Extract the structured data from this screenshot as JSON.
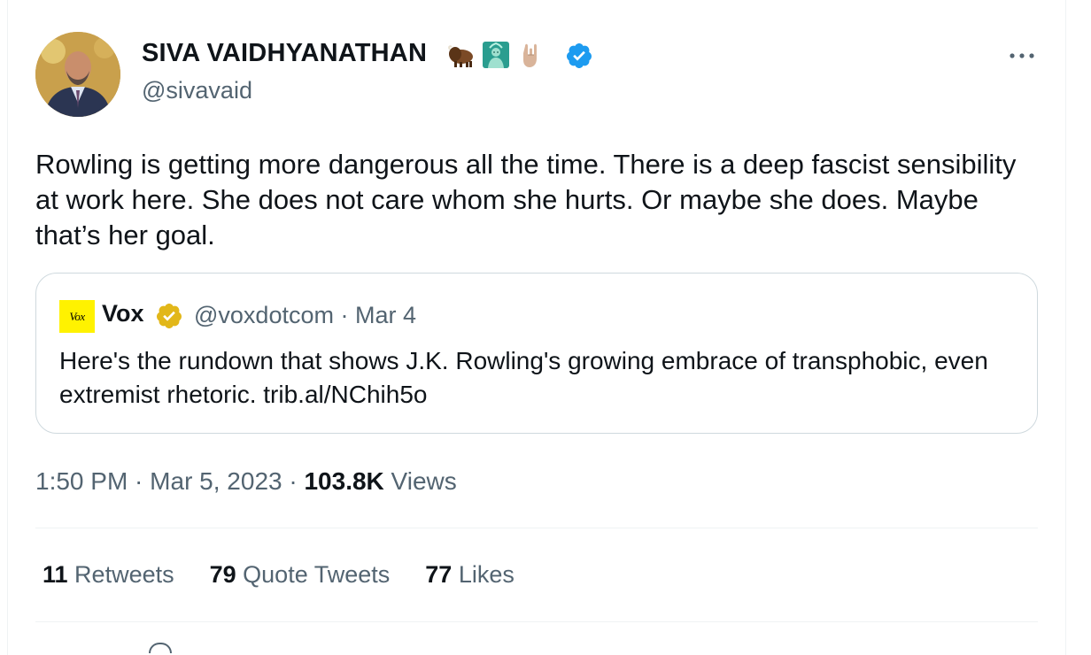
{
  "tweet": {
    "author": {
      "name": "SIVA VAIDHYANATHAN",
      "handle": "@sivavaid",
      "name_emojis": [
        "bison-icon",
        "statue-of-liberty-icon",
        "sign-of-horns-icon"
      ],
      "verified": true
    },
    "text": "Rowling is getting more dangerous all the time. There is a deep fascist sensibility at work here. She does not care whom she hurts. Or maybe she does. Maybe that’s her goal.",
    "quoted": {
      "logo_text": "Vox",
      "name": "Vox",
      "handle": "@voxdotcom",
      "separator": "·",
      "date": "Mar 4",
      "text": "Here's the rundown that shows J.K. Rowling's growing embrace of transphobic, even extremist rhetoric. trib.al/NChih5o",
      "badge": "gold-verified"
    },
    "timestamp": {
      "time": "1:50 PM",
      "sep1": " · ",
      "date": "Mar 5, 2023",
      "sep2": " · ",
      "views_count": "103.8K",
      "views_label": " Views"
    },
    "stats": [
      {
        "count": "11",
        "label": " Retweets"
      },
      {
        "count": "79",
        "label": " Quote Tweets"
      },
      {
        "count": "77",
        "label": " Likes"
      }
    ]
  },
  "colors": {
    "text": "#0f1419",
    "secondary": "#536471",
    "verified_blue": "#1d9bf0",
    "verified_gold": "#e2b719",
    "border": "#cfd9de",
    "vox_yellow": "#fff200"
  }
}
